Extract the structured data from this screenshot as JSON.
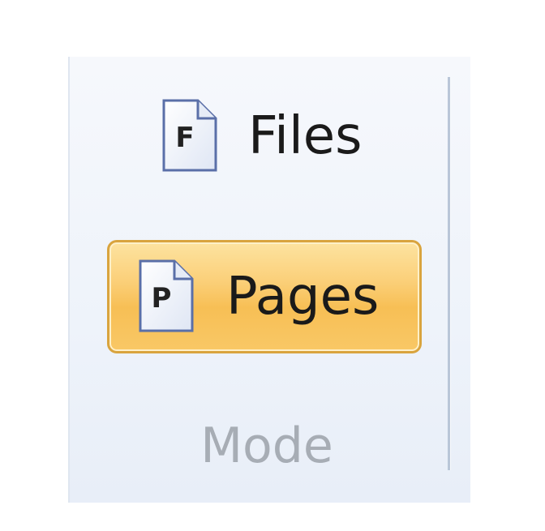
{
  "ribbon": {
    "group": {
      "label": "Mode",
      "buttons": [
        {
          "label": "Files",
          "icon": "document-f-icon",
          "icon_letter": "F",
          "selected": false
        },
        {
          "label": "Pages",
          "icon": "document-p-icon",
          "icon_letter": "P",
          "selected": true
        }
      ]
    }
  },
  "colors": {
    "selected_fill": "#f9c866",
    "selected_border": "#d9a43e",
    "group_background": "#eef3fa",
    "group_label": "#a7adb5"
  }
}
